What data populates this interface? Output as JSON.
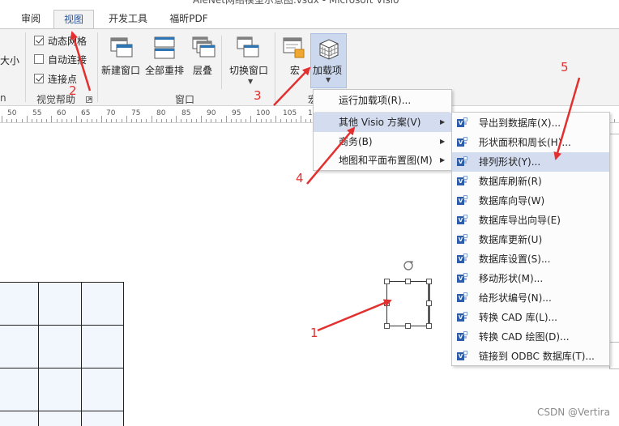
{
  "window": {
    "title": "AieNet网络模型示意图.vsdx - Microsoft Visio"
  },
  "tabs": [
    {
      "label": "审阅",
      "active": false
    },
    {
      "label": "视图",
      "active": true
    },
    {
      "label": "开发工具",
      "active": false
    },
    {
      "label": "福昕PDF",
      "active": false
    }
  ],
  "ribbon": {
    "partial_left_label": "大小",
    "partial_left_group": "n",
    "visual_aids": {
      "group_label": "视觉帮助",
      "items": [
        {
          "label": "动态网格",
          "checked": true
        },
        {
          "label": "自动连接",
          "checked": false
        },
        {
          "label": "连接点",
          "checked": true
        }
      ]
    },
    "window_group": {
      "group_label": "窗口",
      "buttons": [
        {
          "label": "新建窗口",
          "icon": "new-window-icon"
        },
        {
          "label": "全部重排",
          "icon": "arrange-all-icon"
        },
        {
          "label": "层叠",
          "icon": "cascade-icon"
        },
        {
          "label": "切换窗口",
          "icon": "switch-windows-icon"
        }
      ]
    },
    "macros_group": {
      "group_label": "宏",
      "buttons": [
        {
          "label": "宏",
          "icon": "macros-icon"
        },
        {
          "label": "加载项",
          "icon": "add-ins-icon"
        }
      ]
    }
  },
  "ruler": {
    "ticks": [
      "50",
      "55",
      "60",
      "65",
      "70",
      "75",
      "80",
      "85",
      "90",
      "95",
      "100",
      "105",
      "1"
    ]
  },
  "menus": {
    "addins_menu": [
      {
        "label": "运行加载项(R)...",
        "has_submenu": false,
        "highlighted": false
      },
      {
        "label": "其他 Visio 方案(V)",
        "has_submenu": true,
        "highlighted": true
      },
      {
        "label": "商务(B)",
        "has_submenu": true,
        "highlighted": false
      },
      {
        "label": "地图和平面布置图(M)",
        "has_submenu": true,
        "highlighted": false
      }
    ],
    "visio_solutions_submenu": [
      {
        "label": "导出到数据库(X)...",
        "highlighted": false
      },
      {
        "label": "形状面积和周长(H)...",
        "highlighted": false
      },
      {
        "label": "排列形状(Y)...",
        "highlighted": true
      },
      {
        "label": "数据库刷新(R)",
        "highlighted": false
      },
      {
        "label": "数据库向导(W)",
        "highlighted": false
      },
      {
        "label": "数据库导出向导(E)",
        "highlighted": false
      },
      {
        "label": "数据库更新(U)",
        "highlighted": false
      },
      {
        "label": "数据库设置(S)...",
        "highlighted": false
      },
      {
        "label": "移动形状(M)...",
        "highlighted": false
      },
      {
        "label": "给形状编号(N)...",
        "highlighted": false
      },
      {
        "label": "转换 CAD 库(L)...",
        "highlighted": false
      },
      {
        "label": "转换 CAD 绘图(D)...",
        "highlighted": false
      },
      {
        "label": "链接到 ODBC 数据库(T)...",
        "highlighted": false
      }
    ]
  },
  "annotations": [
    "1",
    "2",
    "3",
    "4",
    "5"
  ],
  "watermark": "CSDN @Vertira",
  "colors": {
    "accent": "#2b579a",
    "highlight": "#d4dcf0",
    "annotation": "#e2302f"
  }
}
